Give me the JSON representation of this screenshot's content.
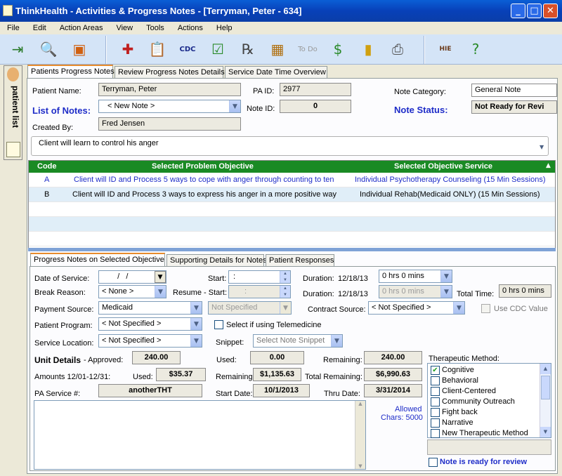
{
  "window": {
    "title": "ThinkHealth - Activities & Progress Notes  - [Terryman, Peter - 634]"
  },
  "menu": [
    "File",
    "Edit",
    "Action Areas",
    "View",
    "Tools",
    "Actions",
    "Help"
  ],
  "side_panel": {
    "label": "patient list"
  },
  "top_tabs": [
    "Patients Progress Notes",
    "Review Progress Notes Details",
    "Service Date Time Overview"
  ],
  "header": {
    "patient_name_label": "Patient Name:",
    "patient_name": "Terryman, Peter",
    "pa_id_label": "PA ID:",
    "pa_id": "2977",
    "note_category_label": "Note Category:",
    "note_category": "General Note",
    "list_of_notes_label": "List of Notes:",
    "list_of_notes_value": "< New Note >",
    "note_id_label": "Note ID:",
    "note_id": "0",
    "note_status_label": "Note Status:",
    "note_status": "Not Ready for Revi",
    "created_by_label": "Created By:",
    "created_by": "Fred Jensen",
    "goal_text": "Client will learn to control his anger"
  },
  "objectives": {
    "columns": [
      "Code",
      "Selected Problem Objective",
      "Selected Objective Service"
    ],
    "rows": [
      {
        "code": "A",
        "objective": "Client will ID and Process 5 ways to cope with anger through counting to ten",
        "service": "Individual Psychotherapy Counseling (15 Min Sessions)"
      },
      {
        "code": "B",
        "objective": "Client will ID and Process 3 ways to express his anger in a more positive way",
        "service": "Individual Rehab(Medicaid ONLY) (15 Min Sessions)"
      }
    ]
  },
  "bottom_tabs": [
    "Progress Notes on Selected Objective",
    "Supporting Details for Notes",
    "Patient Responses"
  ],
  "form": {
    "date_of_service_label": "Date of Service:",
    "date_of_service": "  /   /",
    "start_label": "Start:",
    "start_value": ":",
    "duration_label": "Duration:",
    "duration_date": "12/18/13",
    "duration_value": "0 hrs 0 mins",
    "break_reason_label": "Break Reason:",
    "break_reason": "< None >",
    "resume_start_label": "Resume - Start:",
    "resume_start": ":",
    "duration2_label": "Duration:",
    "duration2_date": "12/18/13",
    "duration2_value": "0 hrs 0 mins",
    "total_time_label": "Total Time:",
    "total_time": "0 hrs 0 mins",
    "payment_source_label": "Payment Source:",
    "payment_source": "Medicaid",
    "not_specified": "Not Specified",
    "contract_source_label": "Contract Source:",
    "contract_source": "< Not Specified >",
    "use_cdc_label": "Use CDC Value",
    "patient_program_label": "Patient Program:",
    "patient_program": "< Not Specified >",
    "telemedicine_label": "Select if using Telemedicine",
    "service_location_label": "Service Location:",
    "service_location": "< Not Specified >",
    "snippet_label": "Snippet:",
    "snippet_placeholder": "Select Note Snippet",
    "unit_details_label": "Unit Details",
    "approved_label": "- Approved:",
    "approved_value": "240.00",
    "used_label": "Used:",
    "used_units": "0.00",
    "remaining_label": "Remaining:",
    "remaining_units": "240.00",
    "amounts_label": "Amounts 12/01-12/31:",
    "amount_used_label": "Used:",
    "amount_used": "$35.37",
    "amount_remaining_label": "Remaining:",
    "amount_remaining": "$1,135.63",
    "total_remaining_label": "Total Remaining:",
    "total_remaining": "$6,990.63",
    "pa_service_label": "PA Service #:",
    "pa_service": "anotherTHT",
    "start_date_label": "Start Date:",
    "start_date": "10/1/2013",
    "thru_date_label": "Thru Date:",
    "thru_date": "3/31/2014",
    "allowed_chars_label": "Allowed",
    "allowed_chars": "Chars: 5000",
    "therapeutic_label": "Therapeutic Method:",
    "therapeutic_methods": [
      {
        "label": "Cognitive",
        "checked": true
      },
      {
        "label": "Behavioral",
        "checked": false
      },
      {
        "label": "Client-Centered",
        "checked": false
      },
      {
        "label": "Community Outreach",
        "checked": false
      },
      {
        "label": "Fight back",
        "checked": false
      },
      {
        "label": "Narrative",
        "checked": false
      },
      {
        "label": "New Therapeutic Method",
        "checked": false
      }
    ],
    "ready_label": "Note is ready for review"
  }
}
